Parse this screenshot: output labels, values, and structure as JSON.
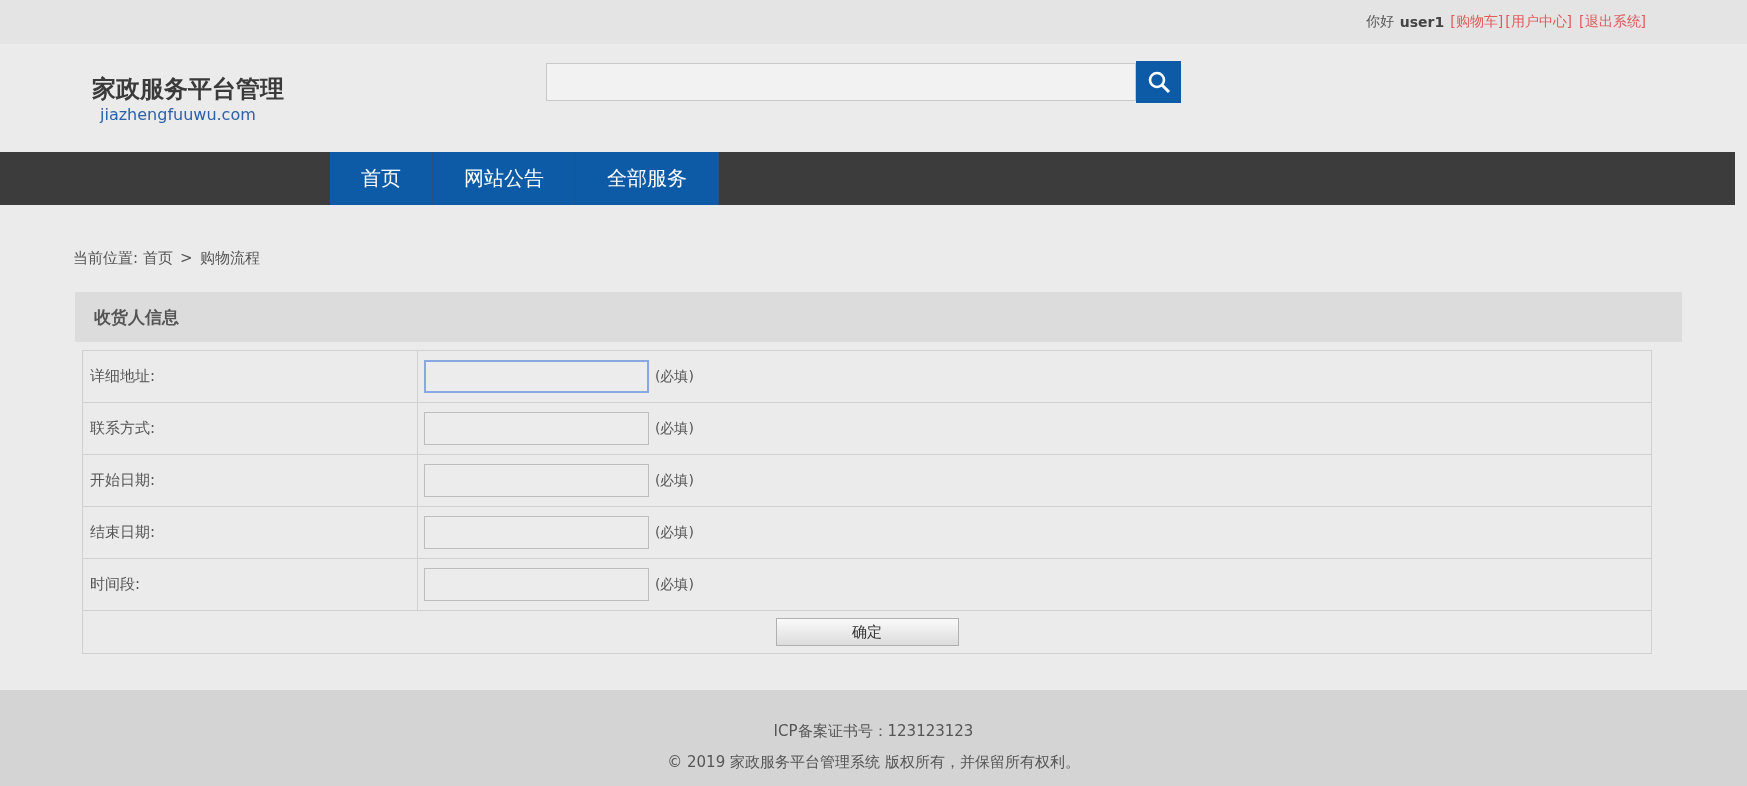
{
  "top_bar": {
    "greeting": "你好",
    "username": "user1",
    "links": [
      "[购物车]",
      "[用户中心]",
      "[退出系统]"
    ]
  },
  "logo": {
    "title": "家政服务平台管理",
    "domain": "jiazhengfuuwu.com"
  },
  "nav": [
    {
      "label": "首页",
      "selected": false
    },
    {
      "label": "网站公告",
      "selected": false
    },
    {
      "label": "全部服务",
      "selected": false
    }
  ],
  "breadcrumb": {
    "prefix": "当前位置:",
    "items": [
      "首页",
      "购物流程"
    ],
    "separator": ">"
  },
  "form": {
    "title": "收货人信息",
    "fields": [
      {
        "label": "详细地址:",
        "note": "(必填)",
        "focused": true
      },
      {
        "label": "联系方式:",
        "note": "(必填)",
        "focused": false
      },
      {
        "label": "开始日期:",
        "note": "(必填)",
        "focused": false
      },
      {
        "label": "结束日期:",
        "note": "(必填)",
        "focused": false
      },
      {
        "label": "时间段:",
        "note": "(必填)",
        "focused": false
      }
    ],
    "submit": "确定"
  },
  "footer": {
    "lines": [
      "ICP备案证书号：123123123",
      "© 2019 家政服务平台管理系统 版权所有，并保留所有权利。"
    ]
  }
}
